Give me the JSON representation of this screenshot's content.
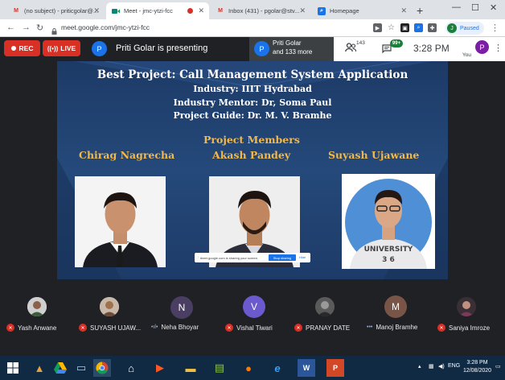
{
  "browser": {
    "tabs": [
      {
        "title": "(no subject) - priticgolar@...",
        "icon": "gmail-icon"
      },
      {
        "title": "Meet - jmc-ytzi-fcc",
        "icon": "meet-icon",
        "active": true,
        "recording": true
      },
      {
        "title": "Inbox (431) - pgolar@stv...",
        "icon": "gmail-icon"
      },
      {
        "title": "Homepage",
        "icon": "homepage-icon"
      }
    ],
    "url": "meet.google.com/jmc-ytzi-fcc",
    "profile_initial": "J",
    "profile_status": "Paused"
  },
  "meet": {
    "rec_label": "REC",
    "live_label": "LIVE",
    "presenter_initial": "P",
    "presenting_text": "Priti Golar is presenting",
    "presenter_card_name": "Priti Golar",
    "presenter_card_more": "and 133 more",
    "participant_count": "143",
    "chat_badge": "99+",
    "time": "3:28 PM",
    "you_label": "You",
    "you_initial": "P"
  },
  "slide": {
    "title": "Best Project: Call Management System Application",
    "industry": "Industry: IIIT Hydrabad",
    "mentor": "Industry Mentor: Dr, Soma Paul",
    "guide": "Project Guide: Dr. M. V. Bramhe",
    "members_heading": "Project Members",
    "members": [
      "Chirag Nagrecha",
      "Akash Pandey",
      "Suyash Ujawane"
    ]
  },
  "share_bar": {
    "message": "meet.google.com is sharing your screen.",
    "stop_label": "Stop sharing",
    "hide_label": "Hide"
  },
  "participants": [
    {
      "name": "Yash Anwane",
      "muted": true,
      "initial": ""
    },
    {
      "name": "SUYASH UJAW...",
      "muted": true,
      "initial": ""
    },
    {
      "name": "Neha Bhoyar",
      "muted": false,
      "initial": "N",
      "color": "#4a3f63"
    },
    {
      "name": "Vishal Tiwari",
      "muted": true,
      "initial": "V",
      "color": "#6a5acd"
    },
    {
      "name": "PRANAY DATE",
      "muted": true,
      "initial": ""
    },
    {
      "name": "Manoj Bramhe",
      "muted": false,
      "initial": "M",
      "color": "#795548"
    },
    {
      "name": "Saniya Imroze",
      "muted": true,
      "initial": ""
    }
  ],
  "taskbar": {
    "lang": "ENG",
    "time": "3:28 PM",
    "date": "12/08/2020"
  }
}
